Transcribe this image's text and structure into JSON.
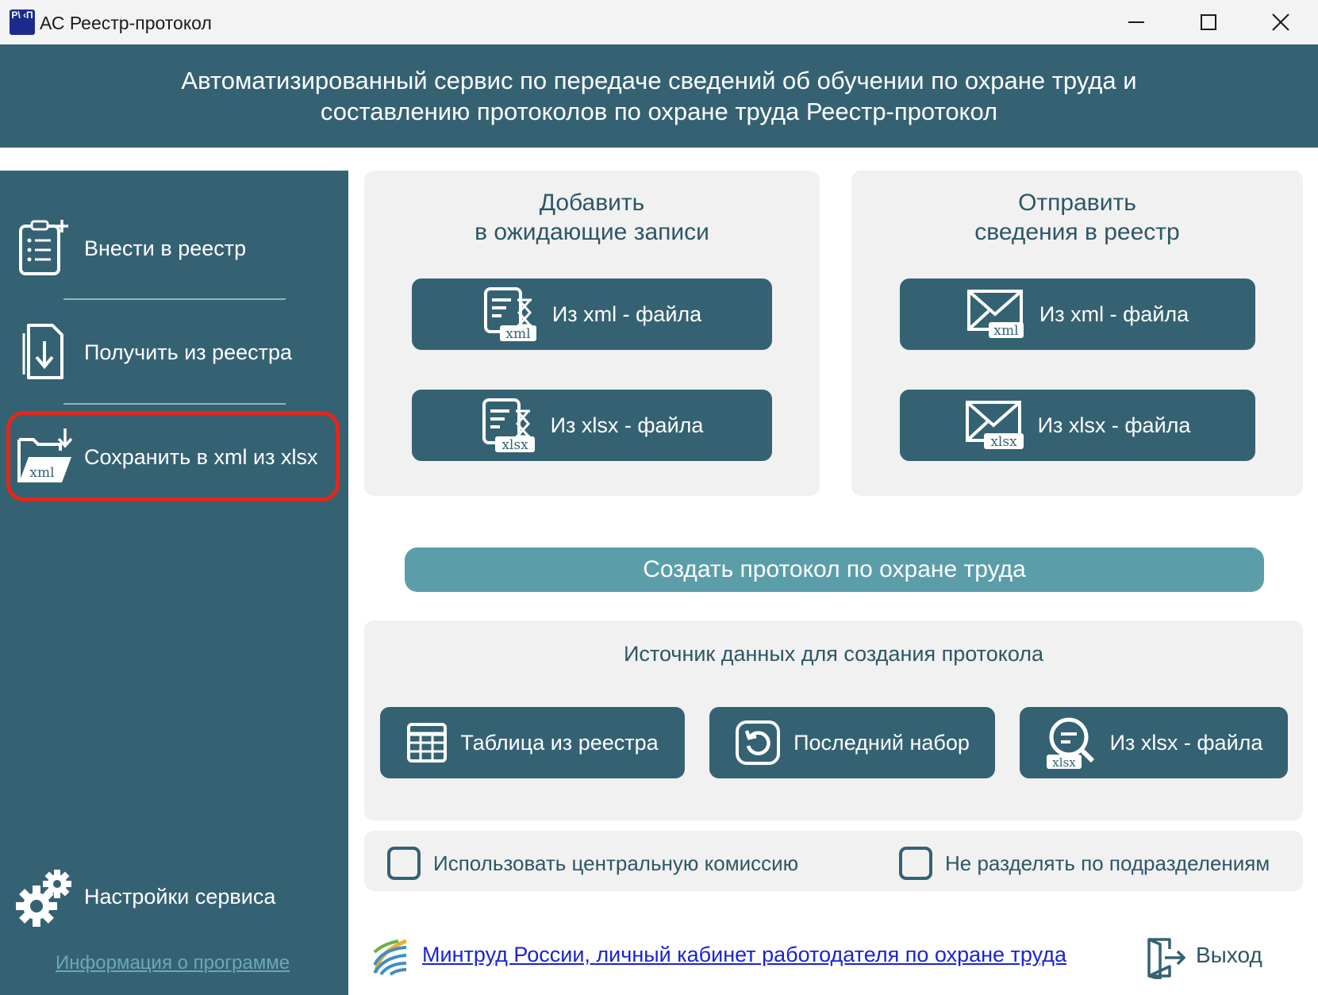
{
  "window": {
    "title": "АС Реестр-протокол",
    "icon_text": "Р\\ ‹П"
  },
  "banner": {
    "line1": "Автоматизированный сервис по передаче сведений об обучении по охране труда и",
    "line2": "составлению протоколов по охране труда Реестр-протокол"
  },
  "sidebar": {
    "items": [
      {
        "label": "Внести в реестр",
        "icon": "clipboard-add-icon"
      },
      {
        "label": "Получить из реестра",
        "icon": "document-download-icon"
      },
      {
        "label": "Сохранить в xml из xlsx",
        "icon": "folder-xml-icon",
        "highlighted": true
      }
    ],
    "settings_label": "Настройки сервиса",
    "info_link": "Информация о программе"
  },
  "add_panel": {
    "title_line1": "Добавить",
    "title_line2": "в ожидающие записи",
    "btn_xml": "Из xml - файла",
    "btn_xlsx": "Из xlsx - файла",
    "tag_xml": "xml",
    "tag_xlsx": "xlsx"
  },
  "send_panel": {
    "title_line1": "Отправить",
    "title_line2": "сведения в реестр",
    "btn_xml": "Из xml - файла",
    "btn_xlsx": "Из xlsx - файла",
    "tag_xml": "xml",
    "tag_xlsx": "xlsx"
  },
  "create_button": "Создать протокол по охране труда",
  "source_panel": {
    "title": "Источник данных для создания протокола",
    "btn_table": "Таблица из реестра",
    "btn_last": "Последний набор",
    "btn_xlsx": "Из xlsx - файла",
    "tag_xlsx": "xlsx"
  },
  "options": {
    "central_commission": {
      "label": "Использовать центральную комиссию",
      "checked": false
    },
    "no_split": {
      "label": "Не разделять по подразделениям",
      "checked": false
    }
  },
  "footer": {
    "mintrud_link": "Минтруд России, личный кабинет работодателя по охране труда",
    "exit_label": "Выход"
  },
  "colors": {
    "primary": "#356273",
    "accent": "#5b9ea9",
    "panel": "#f1f1f1",
    "highlight": "#e4261b",
    "link": "#1a23d6"
  }
}
